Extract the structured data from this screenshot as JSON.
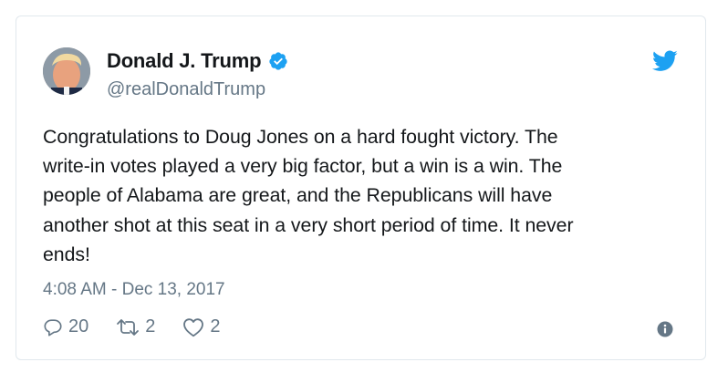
{
  "user": {
    "name": "Donald J. Trump",
    "handle": "@realDonaldTrump",
    "verified": true
  },
  "tweet": {
    "text": "Congratulations to Doug Jones on a hard fought victory. The\nwrite-in votes played a very big factor, but a win is a win. The\npeople of Alabama are great, and the Republicans will have\nanother shot at this seat in a very short period of time. It never\nends!",
    "timestamp": "4:08 AM - Dec 13, 2017"
  },
  "actions": {
    "replies": "20",
    "retweets": "2",
    "likes": "2"
  },
  "icons": {
    "brand": "twitter-bird-icon",
    "verified": "verified-badge-icon",
    "reply": "reply-icon",
    "retweet": "retweet-icon",
    "like": "heart-icon",
    "info": "info-icon"
  },
  "colors": {
    "brand_blue": "#1da1f2",
    "secondary_text": "#657786",
    "primary_text": "#14171a",
    "border": "#e1e8ed"
  }
}
